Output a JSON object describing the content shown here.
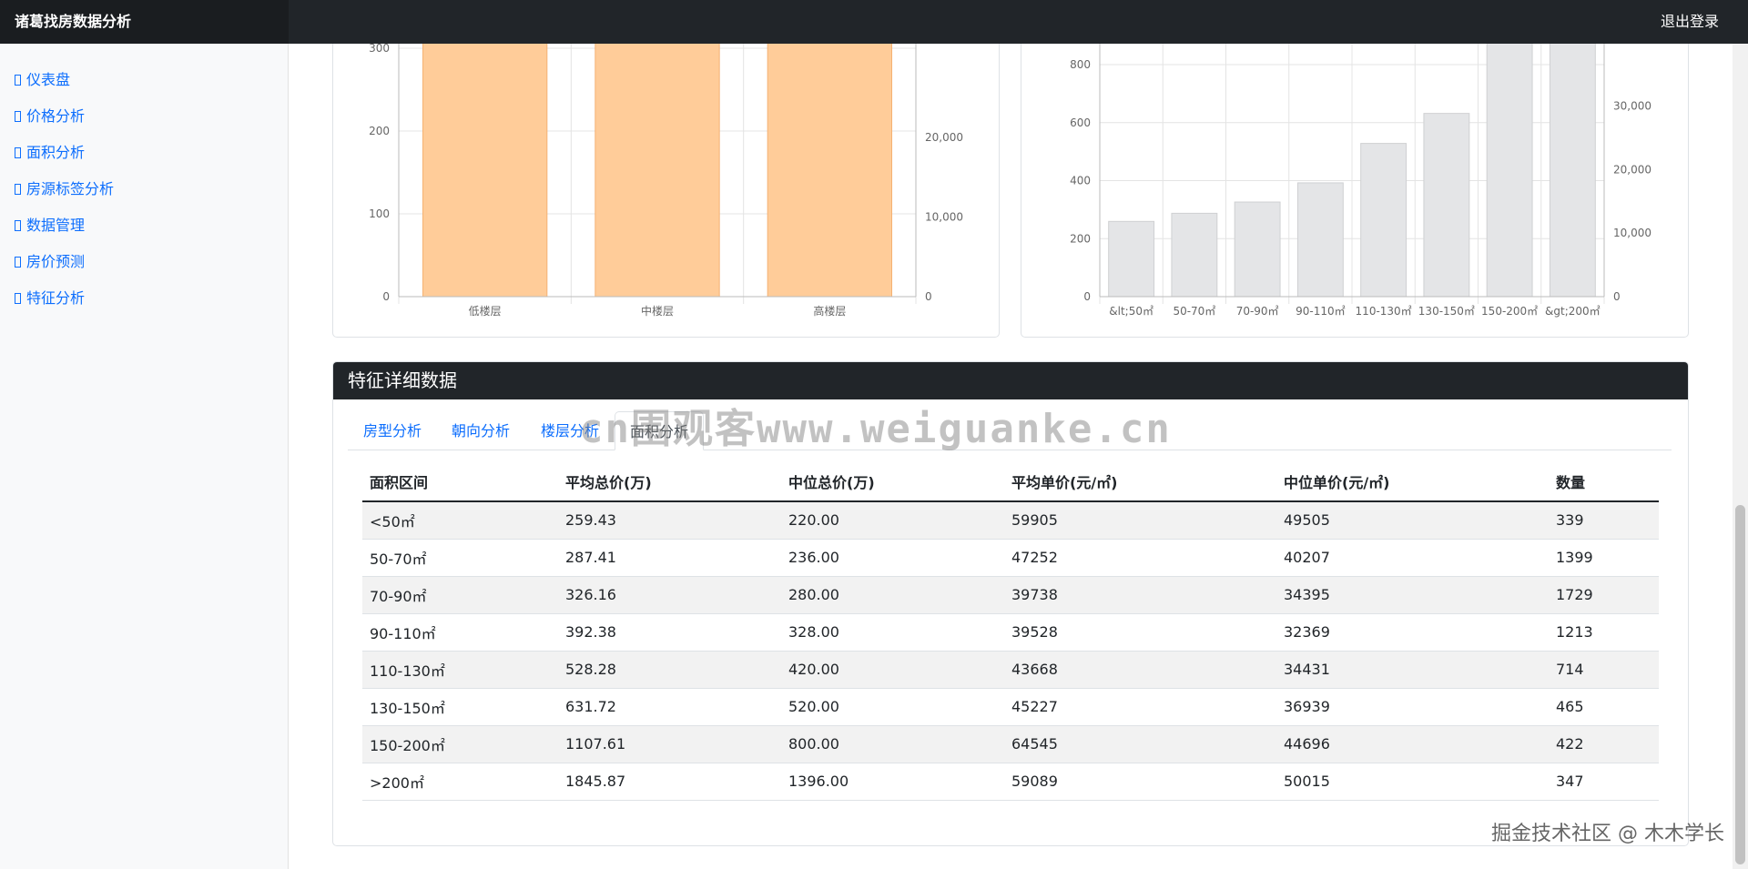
{
  "app": {
    "title": "诸葛找房数据分析",
    "logout": "退出登录"
  },
  "sidebar": {
    "items": [
      {
        "label": "仪表盘"
      },
      {
        "label": "价格分析"
      },
      {
        "label": "面积分析"
      },
      {
        "label": "房源标签分析"
      },
      {
        "label": "数据管理"
      },
      {
        "label": "房价预测"
      },
      {
        "label": "特征分析"
      }
    ]
  },
  "colors": {
    "floor_bar": "#ffcc99",
    "area_bar": "#e4e5e7",
    "navbar": "#212529",
    "link": "#0d6efd"
  },
  "chart_data": [
    {
      "type": "bar",
      "categories": [
        "低楼层",
        "中楼层",
        "高楼层"
      ],
      "series": [
        {
          "values": [
            300,
            300,
            300
          ]
        }
      ],
      "left_ticks": [
        "0",
        "100",
        "200",
        "300"
      ],
      "right_ticks": [
        "0",
        "10,000",
        "20,000"
      ],
      "ylim": [
        0,
        300
      ],
      "grid": true
    },
    {
      "type": "bar",
      "categories": [
        "&lt;50㎡",
        "50-70㎡",
        "70-90㎡",
        "90-110㎡",
        "110-130㎡",
        "130-150㎡",
        "150-200㎡",
        "&gt;200㎡"
      ],
      "series": [
        {
          "values": [
            259.43,
            287.41,
            326.16,
            392.38,
            528.28,
            631.72,
            1107.61,
            1845.87
          ]
        }
      ],
      "left_ticks": [
        "0",
        "200",
        "400",
        "600",
        "800"
      ],
      "right_ticks": [
        "0",
        "10,000",
        "20,000",
        "30,000"
      ],
      "ylim": [
        0,
        800
      ],
      "grid": true
    }
  ],
  "detail": {
    "title": "特征详细数据",
    "tabs": [
      "房型分析",
      "朝向分析",
      "楼层分析",
      "面积分析"
    ],
    "active_tab": "面积分析",
    "columns": [
      "面积区间",
      "平均总价(万)",
      "中位总价(万)",
      "平均单价(元/㎡)",
      "中位单价(元/㎡)",
      "数量"
    ],
    "rows": [
      [
        "<50㎡",
        "259.43",
        "220.00",
        "59905",
        "49505",
        "339"
      ],
      [
        "50-70㎡",
        "287.41",
        "236.00",
        "47252",
        "40207",
        "1399"
      ],
      [
        "70-90㎡",
        "326.16",
        "280.00",
        "39738",
        "34395",
        "1729"
      ],
      [
        "90-110㎡",
        "392.38",
        "328.00",
        "39528",
        "32369",
        "1213"
      ],
      [
        "110-130㎡",
        "528.28",
        "420.00",
        "43668",
        "34431",
        "714"
      ],
      [
        "130-150㎡",
        "631.72",
        "520.00",
        "45227",
        "36939",
        "465"
      ],
      [
        "150-200㎡",
        "1107.61",
        "800.00",
        "64545",
        "44696",
        "422"
      ],
      [
        ">200㎡",
        "1845.87",
        "1396.00",
        "59089",
        "50015",
        "347"
      ]
    ]
  },
  "watermark": {
    "text": "cn围观客www.weiguanke.cn",
    "credit": "掘金技术社区 @ 木木学长"
  }
}
